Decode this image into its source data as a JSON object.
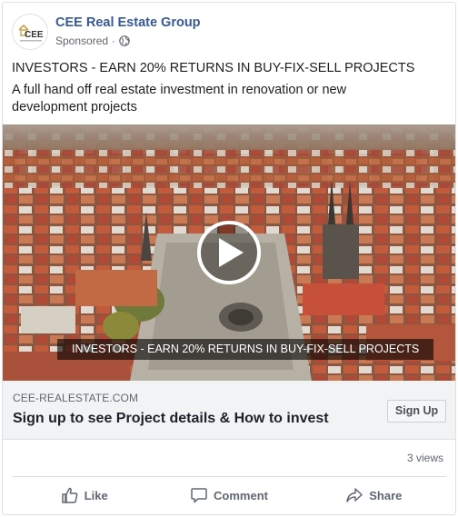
{
  "post": {
    "page_name": "CEE Real Estate Group",
    "sponsored": "Sponsored",
    "separator": "·",
    "logo_text": "CEE",
    "headline": "INVESTORS - EARN 20% RETURNS IN BUY-FIX-SELL PROJECTS",
    "body": "A full hand off real estate investment in renovation or new development projects"
  },
  "media": {
    "caption": "INVESTORS - EARN 20% RETURNS IN BUY-FIX-SELL PROJECTS"
  },
  "link": {
    "domain": "CEE-REALESTATE.COM",
    "title": "Sign up to see Project details & How to invest",
    "cta": "Sign Up"
  },
  "stats": {
    "views": "3 views"
  },
  "actions": {
    "like": "Like",
    "comment": "Comment",
    "share": "Share"
  },
  "colors": {
    "page_name": "#385898",
    "muted": "#606770",
    "link_bar": "#f2f3f5"
  }
}
